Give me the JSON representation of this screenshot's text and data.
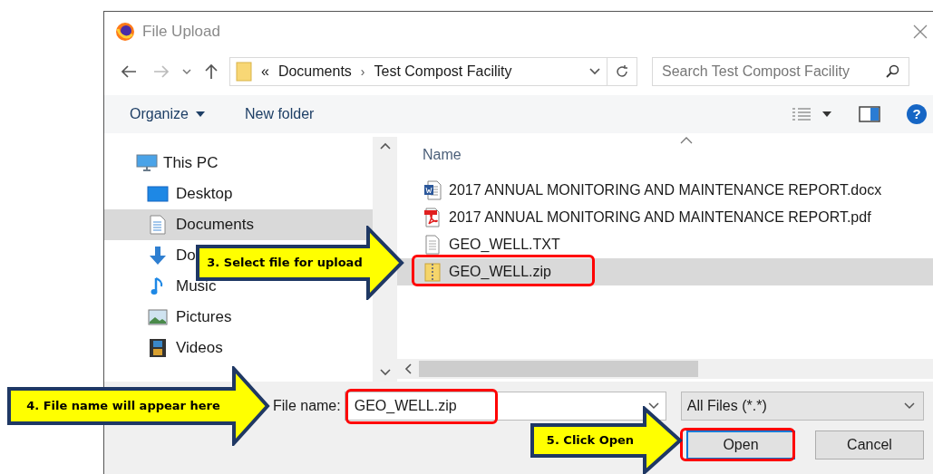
{
  "window": {
    "title": "File Upload"
  },
  "address_bar": {
    "overflow": "«",
    "separator": "›",
    "path": [
      "Documents",
      "Test Compost Facility"
    ]
  },
  "search": {
    "placeholder": "Search Test Compost Facility"
  },
  "toolbar": {
    "buttons": [
      "Organize",
      "New folder"
    ],
    "help": "?"
  },
  "sidebar": {
    "items": [
      {
        "label": "This PC",
        "kind": "pc",
        "selected": false,
        "children": [
          {
            "label": "Desktop",
            "kind": "desktop",
            "selected": false
          },
          {
            "label": "Documents",
            "kind": "documents",
            "selected": true
          },
          {
            "label": "Do",
            "kind": "downloads",
            "selected": false
          },
          {
            "label": "Music",
            "kind": "music",
            "selected": false
          },
          {
            "label": "Pictures",
            "kind": "pictures",
            "selected": false
          },
          {
            "label": "Videos",
            "kind": "videos",
            "selected": false
          }
        ]
      }
    ]
  },
  "file_list": {
    "columns": [
      "Name"
    ],
    "rows": [
      {
        "name": "2017 ANNUAL MONITORING AND MAINTENANCE REPORT.docx",
        "kind": "word",
        "selected": false
      },
      {
        "name": "2017 ANNUAL MONITORING AND MAINTENANCE REPORT.pdf",
        "kind": "pdf",
        "selected": false
      },
      {
        "name": "GEO_WELL.TXT",
        "kind": "text",
        "selected": false
      },
      {
        "name": "GEO_WELL.zip",
        "kind": "zip",
        "selected": true
      }
    ]
  },
  "file_name": {
    "label": "File name:",
    "value": "GEO_WELL.zip"
  },
  "file_type": {
    "value": "All Files (*.*)"
  },
  "buttons": [
    {
      "label": "Open",
      "kind": "primary"
    },
    {
      "label": "Cancel",
      "kind": "secondary"
    }
  ],
  "annotations": [
    {
      "text": "3. Select file for upload"
    },
    {
      "text": "4. File name will appear here"
    },
    {
      "text": "5. Click Open"
    }
  ]
}
